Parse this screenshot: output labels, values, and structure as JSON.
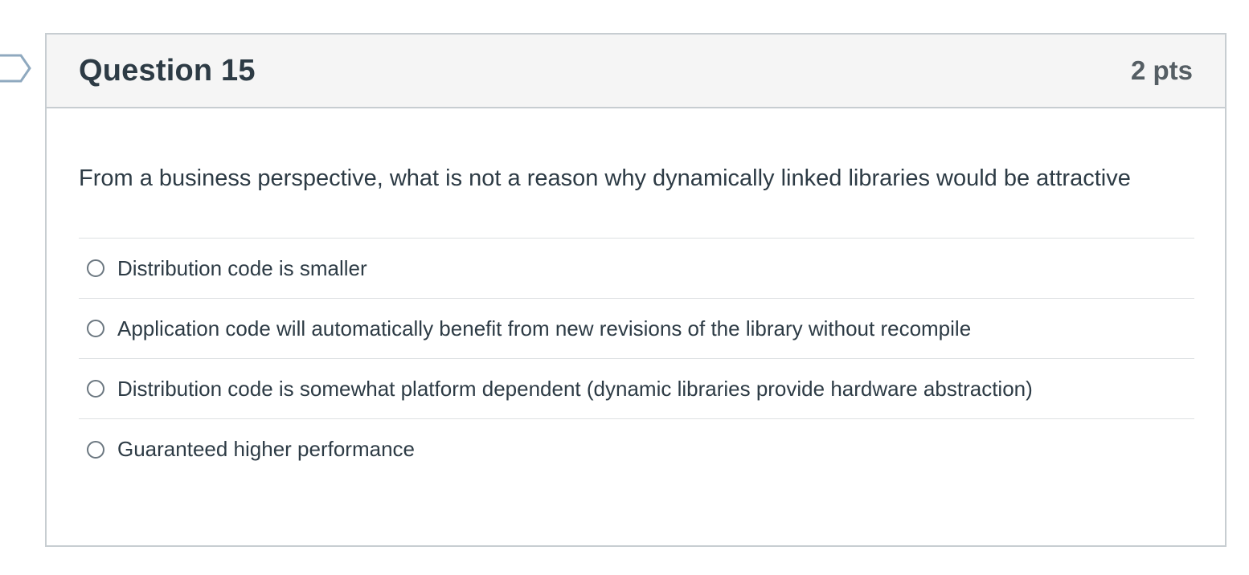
{
  "question": {
    "title": "Question 15",
    "points": "2 pts",
    "text": "From a business perspective, what is not a reason why dynamically linked libraries would be attractive"
  },
  "answers": [
    {
      "label": "Distribution code is smaller",
      "selected": false
    },
    {
      "label": "Application code will automatically benefit from new revisions of the library without recompile",
      "selected": false
    },
    {
      "label": "Distribution code is somewhat platform dependent (dynamic libraries provide hardware abstraction)",
      "selected": false
    },
    {
      "label": "Guaranteed higher performance",
      "selected": false
    }
  ],
  "icons": {
    "flag": "bookmark-flag-icon",
    "radio": "radio-button-icon"
  },
  "colors": {
    "text": "#2d3b45",
    "header_bg": "#f5f5f5",
    "border": "#c7cdd1",
    "flag_outline": "#8fa9bf"
  }
}
